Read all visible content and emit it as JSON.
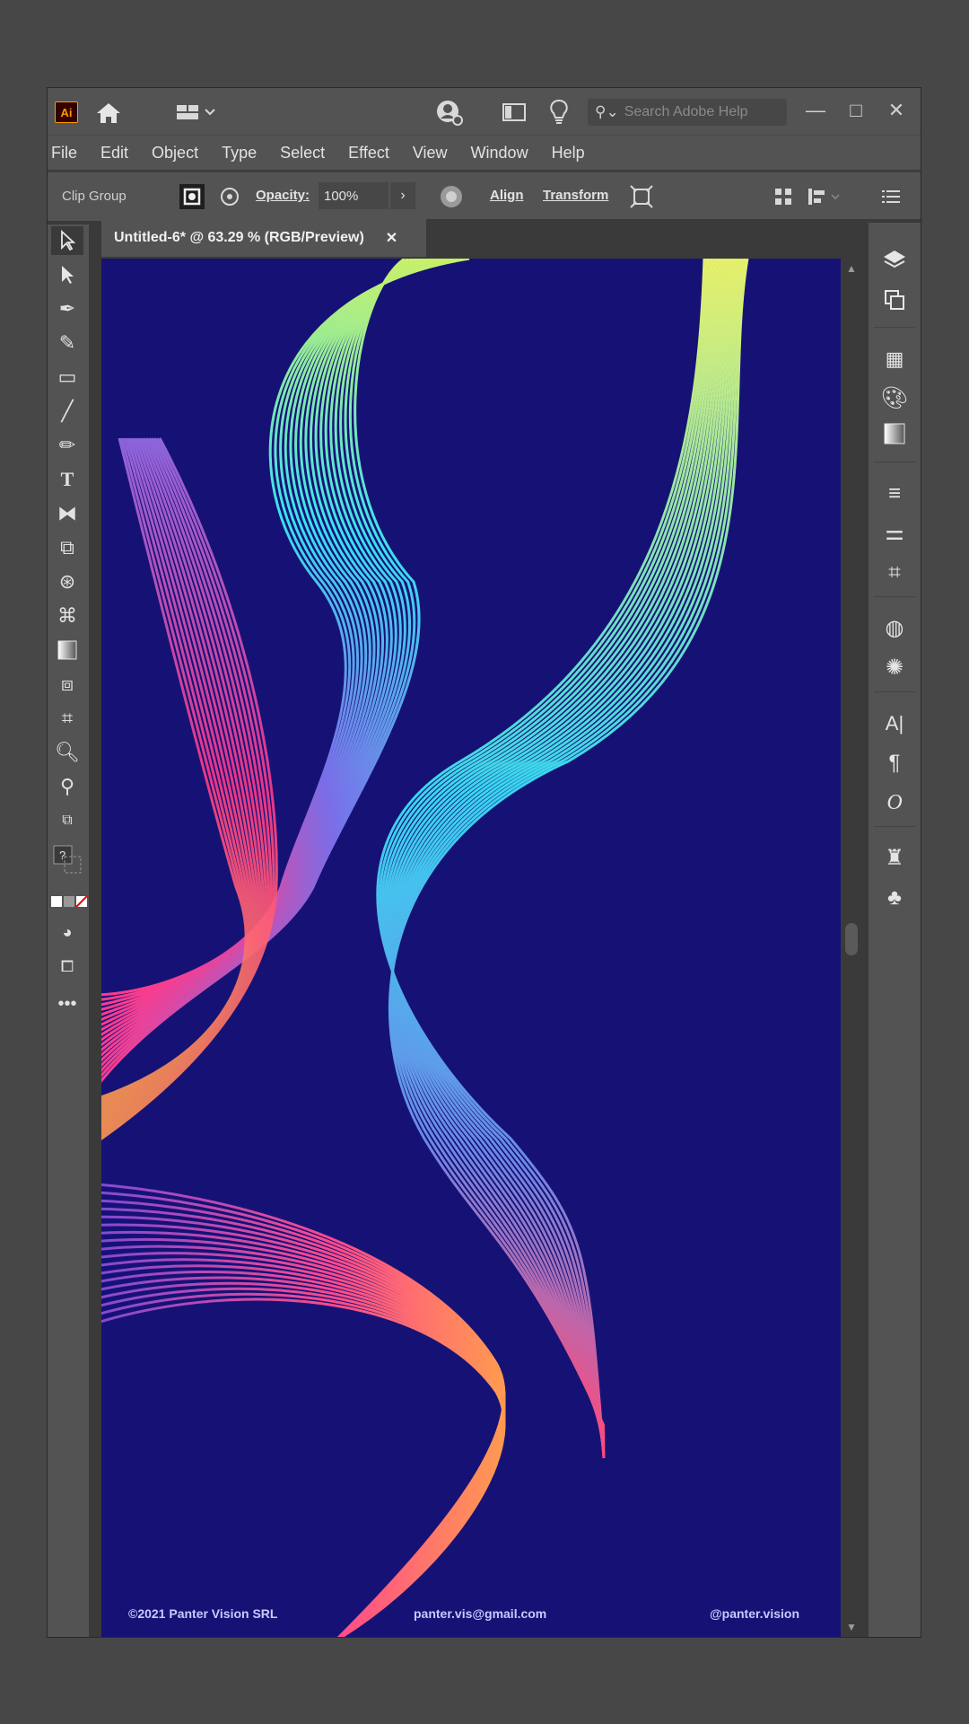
{
  "app": {
    "logo_text": "Ai",
    "accent_color": "#ff9a00"
  },
  "search": {
    "placeholder": "Search Adobe Help"
  },
  "window_controls": {
    "minimize": "—",
    "maximize": "□",
    "close": "✕"
  },
  "menu": [
    "File",
    "Edit",
    "Object",
    "Type",
    "Select",
    "Effect",
    "View",
    "Window",
    "Help"
  ],
  "control_bar": {
    "selection_label": "Clip Group",
    "opacity_label": "Opacity:",
    "opacity_value": "100%",
    "align_label": "Align",
    "transform_label": "Transform"
  },
  "document_tab": {
    "title": "Untitled-6* @ 63.29 % (RGB/Preview)",
    "close": "✕"
  },
  "artwork": {
    "background_color": "#161275",
    "footer_left": "©2021 Panter Vision SRL",
    "footer_center": "panter.vis@gmail.com",
    "footer_right": "@panter.vision"
  },
  "toolbar_icons": [
    "selection-tool",
    "direct-selection-tool",
    "pen-tool",
    "curvature-tool",
    "rectangle-tool",
    "line-tool",
    "pencil-tool",
    "type-tool",
    "reflect-tool",
    "scale-tool",
    "warp-tool",
    "shape-builder-tool",
    "gradient-tool",
    "blend-tool",
    "artboard-tool",
    "zoom-tool",
    "eyedropper-tool"
  ],
  "right_panel_icons": [
    "layers",
    "artboards",
    "swatches",
    "color-guide",
    "gradient",
    "stroke",
    "properties",
    "transform",
    "appearance",
    "graphic-styles",
    "character",
    "paragraph",
    "opentype",
    "symbols",
    "brushes"
  ]
}
